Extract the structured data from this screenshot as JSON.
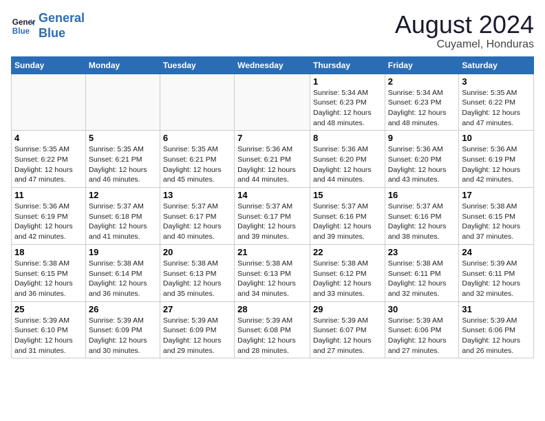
{
  "header": {
    "logo_general": "General",
    "logo_blue": "Blue",
    "month_year": "August 2024",
    "location": "Cuyamel, Honduras"
  },
  "days_of_week": [
    "Sunday",
    "Monday",
    "Tuesday",
    "Wednesday",
    "Thursday",
    "Friday",
    "Saturday"
  ],
  "weeks": [
    [
      {
        "day": "",
        "text": ""
      },
      {
        "day": "",
        "text": ""
      },
      {
        "day": "",
        "text": ""
      },
      {
        "day": "",
        "text": ""
      },
      {
        "day": "1",
        "text": "Sunrise: 5:34 AM\nSunset: 6:23 PM\nDaylight: 12 hours and 48 minutes."
      },
      {
        "day": "2",
        "text": "Sunrise: 5:34 AM\nSunset: 6:23 PM\nDaylight: 12 hours and 48 minutes."
      },
      {
        "day": "3",
        "text": "Sunrise: 5:35 AM\nSunset: 6:22 PM\nDaylight: 12 hours and 47 minutes."
      }
    ],
    [
      {
        "day": "4",
        "text": "Sunrise: 5:35 AM\nSunset: 6:22 PM\nDaylight: 12 hours and 47 minutes."
      },
      {
        "day": "5",
        "text": "Sunrise: 5:35 AM\nSunset: 6:21 PM\nDaylight: 12 hours and 46 minutes."
      },
      {
        "day": "6",
        "text": "Sunrise: 5:35 AM\nSunset: 6:21 PM\nDaylight: 12 hours and 45 minutes."
      },
      {
        "day": "7",
        "text": "Sunrise: 5:36 AM\nSunset: 6:21 PM\nDaylight: 12 hours and 44 minutes."
      },
      {
        "day": "8",
        "text": "Sunrise: 5:36 AM\nSunset: 6:20 PM\nDaylight: 12 hours and 44 minutes."
      },
      {
        "day": "9",
        "text": "Sunrise: 5:36 AM\nSunset: 6:20 PM\nDaylight: 12 hours and 43 minutes."
      },
      {
        "day": "10",
        "text": "Sunrise: 5:36 AM\nSunset: 6:19 PM\nDaylight: 12 hours and 42 minutes."
      }
    ],
    [
      {
        "day": "11",
        "text": "Sunrise: 5:36 AM\nSunset: 6:19 PM\nDaylight: 12 hours and 42 minutes."
      },
      {
        "day": "12",
        "text": "Sunrise: 5:37 AM\nSunset: 6:18 PM\nDaylight: 12 hours and 41 minutes."
      },
      {
        "day": "13",
        "text": "Sunrise: 5:37 AM\nSunset: 6:17 PM\nDaylight: 12 hours and 40 minutes."
      },
      {
        "day": "14",
        "text": "Sunrise: 5:37 AM\nSunset: 6:17 PM\nDaylight: 12 hours and 39 minutes."
      },
      {
        "day": "15",
        "text": "Sunrise: 5:37 AM\nSunset: 6:16 PM\nDaylight: 12 hours and 39 minutes."
      },
      {
        "day": "16",
        "text": "Sunrise: 5:37 AM\nSunset: 6:16 PM\nDaylight: 12 hours and 38 minutes."
      },
      {
        "day": "17",
        "text": "Sunrise: 5:38 AM\nSunset: 6:15 PM\nDaylight: 12 hours and 37 minutes."
      }
    ],
    [
      {
        "day": "18",
        "text": "Sunrise: 5:38 AM\nSunset: 6:15 PM\nDaylight: 12 hours and 36 minutes."
      },
      {
        "day": "19",
        "text": "Sunrise: 5:38 AM\nSunset: 6:14 PM\nDaylight: 12 hours and 36 minutes."
      },
      {
        "day": "20",
        "text": "Sunrise: 5:38 AM\nSunset: 6:13 PM\nDaylight: 12 hours and 35 minutes."
      },
      {
        "day": "21",
        "text": "Sunrise: 5:38 AM\nSunset: 6:13 PM\nDaylight: 12 hours and 34 minutes."
      },
      {
        "day": "22",
        "text": "Sunrise: 5:38 AM\nSunset: 6:12 PM\nDaylight: 12 hours and 33 minutes."
      },
      {
        "day": "23",
        "text": "Sunrise: 5:38 AM\nSunset: 6:11 PM\nDaylight: 12 hours and 32 minutes."
      },
      {
        "day": "24",
        "text": "Sunrise: 5:39 AM\nSunset: 6:11 PM\nDaylight: 12 hours and 32 minutes."
      }
    ],
    [
      {
        "day": "25",
        "text": "Sunrise: 5:39 AM\nSunset: 6:10 PM\nDaylight: 12 hours and 31 minutes."
      },
      {
        "day": "26",
        "text": "Sunrise: 5:39 AM\nSunset: 6:09 PM\nDaylight: 12 hours and 30 minutes."
      },
      {
        "day": "27",
        "text": "Sunrise: 5:39 AM\nSunset: 6:09 PM\nDaylight: 12 hours and 29 minutes."
      },
      {
        "day": "28",
        "text": "Sunrise: 5:39 AM\nSunset: 6:08 PM\nDaylight: 12 hours and 28 minutes."
      },
      {
        "day": "29",
        "text": "Sunrise: 5:39 AM\nSunset: 6:07 PM\nDaylight: 12 hours and 27 minutes."
      },
      {
        "day": "30",
        "text": "Sunrise: 5:39 AM\nSunset: 6:06 PM\nDaylight: 12 hours and 27 minutes."
      },
      {
        "day": "31",
        "text": "Sunrise: 5:39 AM\nSunset: 6:06 PM\nDaylight: 12 hours and 26 minutes."
      }
    ]
  ]
}
